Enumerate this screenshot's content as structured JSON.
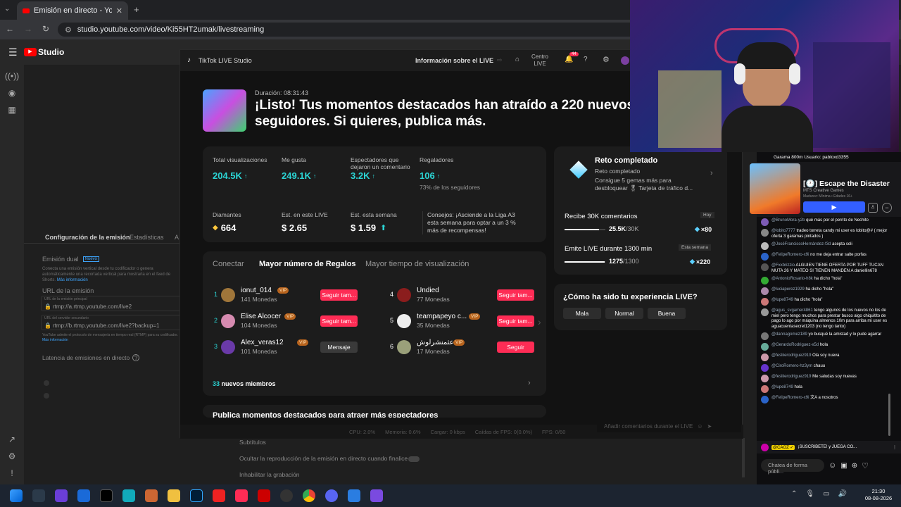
{
  "browser": {
    "tab_title": "Emisión en directo - YouTube S",
    "url": "studio.youtube.com/video/Ki55HT2umak/livestreaming"
  },
  "yt": {
    "logo": "Studio",
    "tabs": [
      "Configuración de la emisión",
      "Estadísticas",
      "A"
    ],
    "dual_label": "Emisión dual",
    "dual_badge": "Nuevo",
    "dual_desc": "Conecta una emisión vertical desde tu codificador o genera automáticamente una recortada vertical para mostrarla en el feed de Shorts.",
    "dual_link": "Más información",
    "url_label": "URL de la emisión",
    "url_main_label": "URL de la emisión principal",
    "url_main": "rtmp://a.rtmp.youtube.com/live2",
    "url_backup_label": "URL del servidor secundario",
    "url_backup": "rtmp://b.rtmp.youtube.com/live2?backup=1",
    "url_note": "YouTube admite el protocolo de mensajería en tiempo real (RTMP) para su codificador.",
    "url_note_link": "Más información",
    "latency_label": "Latencia de emisiones en directo",
    "subtitles": "Subtítulos",
    "hide_replay": "Ocultar la reproducción de la emisión en directo cuando finalice",
    "disable_rec": "Inhabilitar la grabación",
    "comment_placeholder": "Añadir comentarios durante el LIVE"
  },
  "tiktok": {
    "app_title": "TikTok LIVE Studio",
    "nav_info": "Información sobre el LIVE",
    "nav_center": "Centro LIVE",
    "notif_count": "44",
    "duration": "Duración: 08:31:43",
    "headline": "¡Listo! Tus momentos destacados han atraído a 220 nuevos seguidores. Si quieres, publica más.",
    "stats": [
      {
        "label": "Total visualizaciones",
        "value": "204.5K"
      },
      {
        "label": "Me gusta",
        "value": "249.1K"
      },
      {
        "label": "Espectadores que dejaron un comentario",
        "value": "3.2K"
      },
      {
        "label": "Regaladores",
        "value": "106",
        "sub": "73% de los seguidores"
      }
    ],
    "diamonds": {
      "label": "Diamantes",
      "value": "664"
    },
    "est_live": {
      "label": "Est. en este LIVE",
      "value": "$ 2.65"
    },
    "est_week": {
      "label": "Est. esta semana",
      "value": "$ 1.59"
    },
    "tip": "Consejos: ¡Asciende a la Liga A3 esta semana para optar a un 3 % más de recompensas!",
    "tabs": [
      "Conectar",
      "Mayor número de Regalos",
      "Mayor tiempo de visualización"
    ],
    "gifters": [
      {
        "rank": "1",
        "name": "ionut_014",
        "coins": "141 Monedas",
        "btn": "Seguir tam..."
      },
      {
        "rank": "2",
        "name": "Elise Alcocer",
        "coins": "104 Monedas",
        "btn": "Seguir tam..."
      },
      {
        "rank": "3",
        "name": "Alex_veras12",
        "coins": "101 Monedas",
        "btn": "Mensaje"
      },
      {
        "rank": "4",
        "name": "Undied",
        "coins": "77 Monedas",
        "btn": "Seguir tam..."
      },
      {
        "rank": "5",
        "name": "teampapeyo c...",
        "coins": "35 Monedas",
        "btn": "Seguir tam..."
      },
      {
        "rank": "6",
        "name": "عثمنشرلوش",
        "coins": "17 Monedas",
        "btn": "Seguir"
      }
    ],
    "vip": "VIP",
    "new_members_count": "33",
    "new_members": "nuevos miembros",
    "publish_more": "Publica momentos destacados para atraer más espectadores",
    "challenge": {
      "title": "Reto completado",
      "subtitle": "Reto completado",
      "desc": "Consigue 5 gemas más para desbloquear 🎖 Tarjeta de tráfico d...",
      "goal1": "Recibe 30K comentarios",
      "goal1_badge": "Hoy",
      "goal1_cur": "25.5K",
      "goal1_total": "30K",
      "goal1_reward": "×80",
      "goal1_progress": 0.85,
      "goal2": "Emite LIVE durante 1300 min",
      "goal2_badge": "Esta semana",
      "goal2_cur": "1275",
      "goal2_total": "1300",
      "goal2_reward": "×220",
      "goal2_progress": 0.98
    },
    "feedback": {
      "q": "¿Cómo ha sido tu experiencia LIVE?",
      "opts": [
        "Mala",
        "Normal",
        "Buena"
      ]
    },
    "statusbar": {
      "cpu": "CPU: 2.0%",
      "mem": "Memoria: 0.6%",
      "load": "Cargar: 0 kbps",
      "fps_drop": "Caídas de FPS: 0(0.0%)",
      "fps": "FPS: 0/60"
    }
  },
  "stream_overlay": {
    "garama": "Garama 800m Usuario: pabloxd3355",
    "game_title": "[🕐] Escape the Disaster",
    "game_studio": "MTS Creative Games",
    "game_meta": "Madurez: Mínima • Edades 16+",
    "chat": [
      {
        "user": "@BrunoMora-y2b",
        "msg": "qué más por el perrito de Nechito",
        "c": "#7d5bb5"
      },
      {
        "user": "@lobito7777",
        "msg": "tradeo torreta candy mi user es lobito@# ( mejor oferta 3 garamas pintados )",
        "c": "#888"
      },
      {
        "user": "@JoséFranciscoHernández-f3d",
        "msg": "acepta soli",
        "c": "#bbb"
      },
      {
        "user": "@FelipeRomero-x9i",
        "msg": "no me deja entrar salte porfas",
        "c": "#2a63c9"
      },
      {
        "user": "@Fxxbrizzio",
        "msg": "ALGUIEN TIENE OFERTA POR TUFF TUCAN MUTA 26 Y MATEO SI TIENEN MANDEN A daniellin678",
        "c": "#555"
      },
      {
        "user": "@AntonioRosario-h8k",
        "msg": "ha dicho \"hola\"",
        "c": "#3a3"
      },
      {
        "user": "@luciaperez1929",
        "msg": "ha dicho \"hola\"",
        "c": "#a8a"
      },
      {
        "user": "@lupe8749",
        "msg": "ha dicho \"hola\"",
        "c": "#c77"
      },
      {
        "user": "@agus_svgamer4861",
        "msg": "tengo algunos de los nuevos no los de miel pero tengo muchos para prestar busco algo chiquitito de pago lo ago por máquina almenos 10m para arriba mi user es aguacuentasecret1203 (no tengo tanto)",
        "c": "#999"
      },
      {
        "user": "@dannagomez189",
        "msg": "yo busqué la amistad y lo pude agarrar",
        "c": "#777"
      },
      {
        "user": "@GerardoRodriguez-x5d",
        "msg": "hola",
        "c": "#6a9"
      },
      {
        "user": "@fesliierodriguez919",
        "msg": "Ola soy nueva",
        "c": "#c9a"
      },
      {
        "user": "@CiroRomero-hz3ym",
        "msg": "chauu",
        "c": "#63c"
      },
      {
        "user": "@fesliierodriguez919",
        "msg": "Me saludas soy nuevas",
        "c": "#c9a"
      },
      {
        "user": "@lupe8749",
        "msg": "hola",
        "c": "#c77"
      },
      {
        "user": "@FelipeRomero-x9i",
        "msg": "文A a nosotros",
        "c": "#2a63c9"
      }
    ],
    "pinned_user": "@CAOZ ✓",
    "pinned_msg": "¡SUSCRIBETE! y JUEGA CO...",
    "chat_placeholder": "Chatea de forma públi..."
  },
  "taskbar": {
    "time": "21:30",
    "date": "08-08-2026"
  }
}
